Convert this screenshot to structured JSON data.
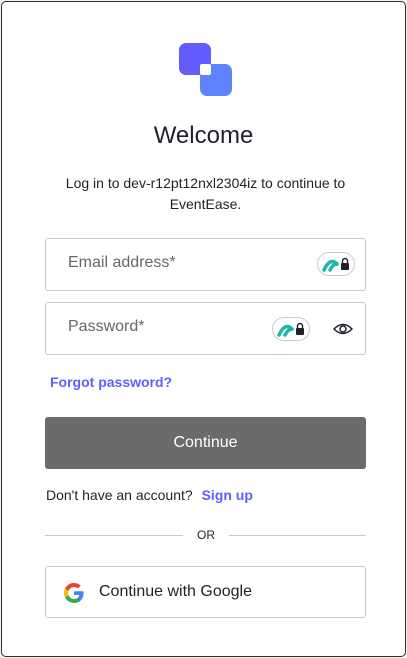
{
  "brand": {
    "logo_icon": "stacked-squares-logo",
    "colors": {
      "logo_primary": "#635dff",
      "logo_secondary": "#5f82ff"
    }
  },
  "header": {
    "title": "Welcome",
    "subtitle": "Log in to dev-r12pt12nxl2304iz to continue to EventEase."
  },
  "form": {
    "email": {
      "placeholder": "Email address*",
      "value": ""
    },
    "password": {
      "placeholder": "Password*",
      "value": ""
    },
    "password_manager_icon": "password-manager-icon",
    "show_password_icon": "eye-icon",
    "forgot_password": "Forgot password?",
    "continue_label": "Continue"
  },
  "signup": {
    "prompt": "Don't have an account?",
    "link": "Sign up"
  },
  "divider": {
    "label": "OR"
  },
  "social": {
    "google_label": "Continue with Google",
    "google_icon": "google-icon"
  },
  "colors": {
    "accent": "#635dff",
    "button": "#6b6b6b",
    "border": "#c9cace",
    "text": "#1e212a"
  }
}
